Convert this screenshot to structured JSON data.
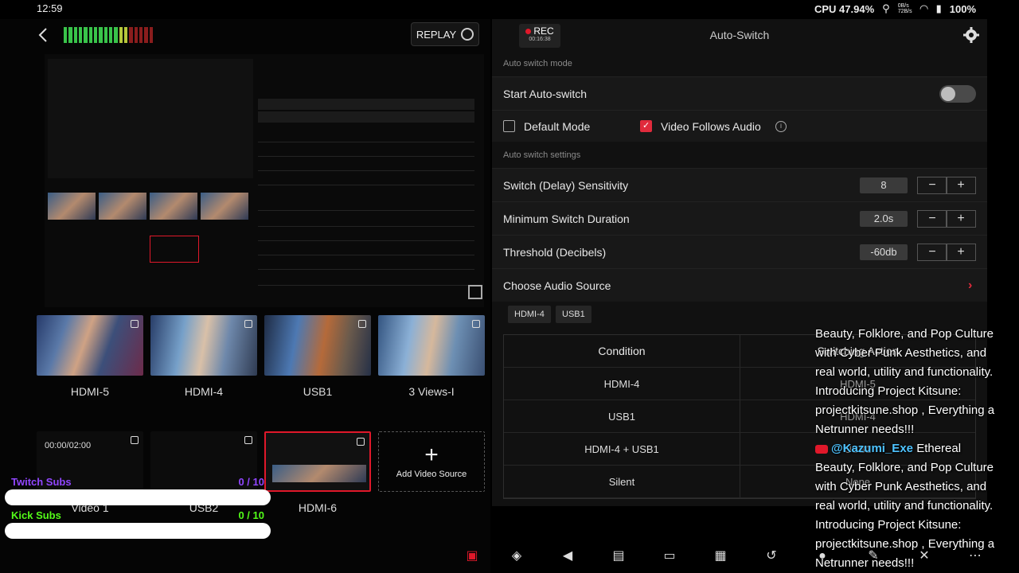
{
  "status": {
    "time": "12:59",
    "cpu": "CPU 47.94%",
    "net_up": "0B/s",
    "net_down": "72B/s",
    "battery": "100%"
  },
  "left": {
    "replay_label": "REPLAY",
    "sources": [
      {
        "label": "HDMI-5",
        "style": "hdmi5"
      },
      {
        "label": "HDMI-4",
        "style": "hdmi4"
      },
      {
        "label": "USB1",
        "style": "usb1"
      },
      {
        "label": "3 Views-I",
        "style": "views3"
      }
    ],
    "sources_row2": [
      {
        "label": "Video 1",
        "timecode": "00:00/02:00"
      },
      {
        "label": "USB2"
      },
      {
        "label": "HDMI-6"
      }
    ],
    "add_source_label": "Add Video Source"
  },
  "overlay": {
    "twitch_label": "Twitch Subs",
    "twitch_count": "0 / 10",
    "twitch_color": "#9146ff",
    "kick_label": "Kick Subs",
    "kick_count": "0 / 10",
    "kick_color": "#53fc18",
    "ticker_lines": [
      "Beauty, Folklore, and Pop Culture",
      "with Cyber Punk Aesthetics, and",
      "real world, utility and functionality.",
      "Introducing Project Kitsune:",
      "projectkitsune.shop , Everything a",
      "Netrunner needs!!!"
    ],
    "ticker_handle": "@Kazumi_Exe",
    "ticker_handle_suffix": "Ethereal",
    "ticker_lines2": [
      "Beauty, Folklore, and Pop Culture",
      "with Cyber Punk Aesthetics, and",
      "real world, utility and functionality.",
      "Introducing Project Kitsune:",
      "projectkitsune.shop , Everything a",
      "Netrunner needs!!!"
    ]
  },
  "right": {
    "rec_label": "REC",
    "rec_time": "00:16:38",
    "title": "Auto-Switch",
    "section_mode": "Auto switch mode",
    "start_label": "Start Auto-switch",
    "start_on": false,
    "default_mode_label": "Default Mode",
    "video_follows_label": "Video Follows Audio",
    "section_settings": "Auto switch settings",
    "settings": [
      {
        "label": "Switch (Delay) Sensitivity",
        "value": "8"
      },
      {
        "label": "Minimum Switch Duration",
        "value": "2.0s"
      },
      {
        "label": "Threshold (Decibels)",
        "value": "-60db"
      }
    ],
    "audio_source_label": "Choose Audio Source",
    "audio_chips": [
      "HDMI-4",
      "USB1"
    ],
    "table_headers": [
      "Condition",
      "Switching Action"
    ],
    "table_rows": [
      {
        "condition": "HDMI-4",
        "action": "HDMI-5"
      },
      {
        "condition": "USB1",
        "action": "HDMI-4"
      },
      {
        "condition": "HDMI-4 + USB1",
        "action": "USB1"
      },
      {
        "condition": "Silent",
        "action": "None"
      }
    ]
  },
  "colors": {
    "accent": "#e0182a",
    "bg": "#000000",
    "panel": "#181818"
  }
}
